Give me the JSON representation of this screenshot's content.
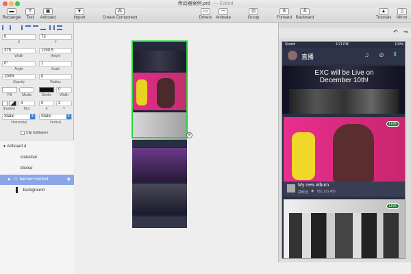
{
  "window": {
    "title": "传动器案例.prd",
    "edited": "— Edited"
  },
  "toolbar": {
    "items": [
      {
        "label": "Rectangle"
      },
      {
        "label": "Text"
      },
      {
        "label": "Artboard"
      },
      {
        "label": "Import"
      },
      {
        "label": "Create Component"
      },
      {
        "label": "Drivers"
      },
      {
        "label": "Animate"
      },
      {
        "label": "Group"
      },
      {
        "label": "Forward"
      },
      {
        "label": "Backward"
      },
      {
        "label": "Tutorials"
      },
      {
        "label": "Mirror"
      }
    ]
  },
  "inspector": {
    "x": "0",
    "y": "73",
    "x_label": "X",
    "y_label": "Y",
    "width": "375",
    "height": "1190.5",
    "width_label": "Width",
    "height_label": "Height",
    "angle": "0°",
    "scale": "1",
    "angle_label": "Angle",
    "scale_label": "Scale",
    "opacity": "100%",
    "radius": "0",
    "opacity_label": "Opacity",
    "radius_label": "Radius",
    "fill_label": "Fill",
    "media_label": "Media",
    "stroke_label": "Stroke",
    "stroke_width": "0",
    "stroke_width_label": "Width",
    "blur": "4",
    "shadow_x": "0",
    "shadow_y": "2",
    "shadow_label": "Shadow",
    "blur_label": "Blur",
    "sx_label": "X",
    "sy_label": "Y",
    "horizontal": "Static",
    "vertical": "Static",
    "horizontal_label": "Horizontal",
    "vertical_label": "Vertical",
    "clip_label": "Clip Sublayers"
  },
  "layers": [
    {
      "name": "Artboard 4"
    },
    {
      "name": "statusbar"
    },
    {
      "name": "titlebar"
    },
    {
      "name": "banner+content"
    },
    {
      "name": "background"
    }
  ],
  "phone": {
    "carrier": "Sketch",
    "time": "4:21 PM",
    "battery": "100%",
    "app_title": "直播",
    "banner_line1": "EXC will be Live on",
    "banner_line2": "December 10th!",
    "live_badge": "LIVE",
    "card_title": "My new album",
    "card_author": "郑晓洁",
    "card_views": "782,123,456",
    "live_badge2": "LIVE"
  }
}
